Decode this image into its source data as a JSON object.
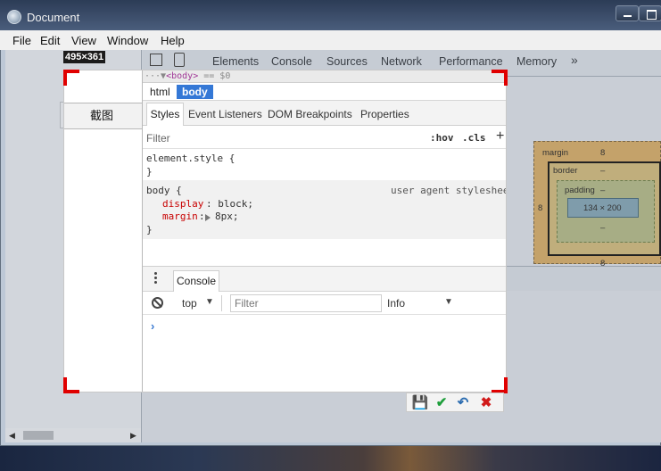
{
  "window": {
    "title": "Document"
  },
  "menu": [
    "File",
    "Edit",
    "View",
    "Window",
    "Help"
  ],
  "capture": {
    "size_label": "495×361"
  },
  "page": {
    "button_label": "截图"
  },
  "devtools": {
    "tabs": [
      "Elements",
      "Console",
      "Sources",
      "Network",
      "Performance",
      "Memory"
    ],
    "more_tabs_icon": "»",
    "crumb_strip": {
      "prefix": "···▼",
      "tag": "<body>",
      "suffix": "== $0"
    },
    "crumbs": [
      "html",
      "body"
    ],
    "subtabs": [
      "Styles",
      "Event Listeners",
      "DOM Breakpoints",
      "Properties"
    ],
    "styles": {
      "filter_placeholder": "Filter",
      "hov": ":hov",
      "cls": ".cls",
      "add": "+",
      "rule1_selector": "element.style {",
      "rule1_close": "}",
      "rule2_selector": "body {",
      "rule2_source": "user agent stylesheet",
      "rule2_prop1_name": "display",
      "rule2_prop1_value": ": block;",
      "rule2_prop2_name": "margin",
      "rule2_prop2_value": "8px;",
      "rule2_close": "}"
    },
    "box_model": {
      "margin_label": "margin",
      "margin_top": "8",
      "margin_left": "8",
      "margin_bottom": "8",
      "border_label": "border",
      "border_value": "–",
      "padding_label": "padding",
      "padding_value": "–",
      "padding_bottom": "–",
      "content": "134 × 200"
    },
    "drawer": {
      "tab": "Console",
      "context": "top",
      "filter_placeholder": "Filter",
      "level": "Info",
      "prompt": "›"
    }
  },
  "capture_toolbar": {
    "save": "💾",
    "ok": "✔",
    "undo": "↶",
    "cancel": "✖"
  }
}
